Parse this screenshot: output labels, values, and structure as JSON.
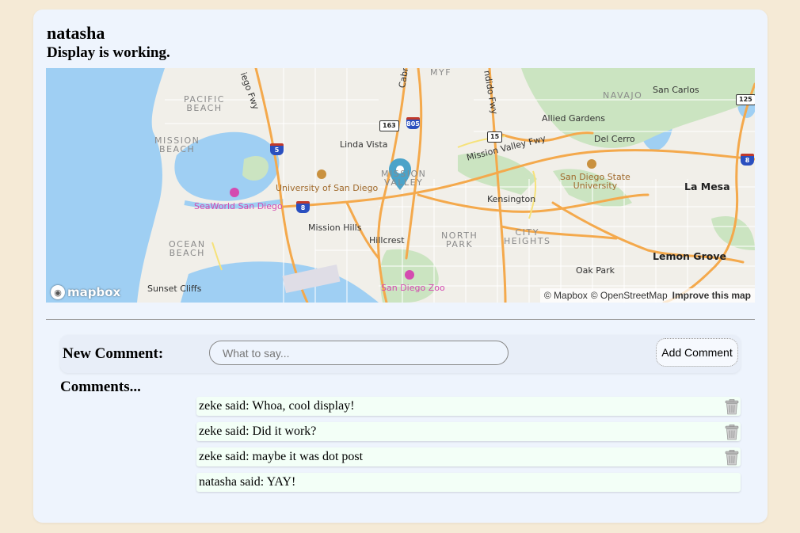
{
  "header": {
    "title": "natasha",
    "subtitle": "Display is working."
  },
  "map": {
    "labels": {
      "pacific_beach": "PACIFIC\nBEACH",
      "mission_beach": "MISSION\nBEACH",
      "ocean_beach": "OCEAN\nBEACH",
      "linda_vista": "Linda Vista",
      "mission_valley": "MISSION\nVALLEY",
      "allied_gardens": "Allied Gardens",
      "san_carlos": "San Carlos",
      "navajo": "NAVAJO",
      "del_cerro": "Del Cerro",
      "mission_valley_fwy": "Mission Valley Fwy",
      "university_san_diego": "University of San Diego",
      "seaworld": "SeaWorld San Diego",
      "kensington": "Kensington",
      "sdsu": "San Diego State\nUniversity",
      "la_mesa": "La Mesa",
      "mission_hills": "Mission Hills",
      "hillcrest": "Hillcrest",
      "north_park": "NORTH\nPARK",
      "city_heights": "CITY\nHEIGHTS",
      "lemon_grove": "Lemon Grove",
      "oak_park": "Oak Park",
      "sunset_cliffs": "Sunset Cliffs",
      "san_diego_zoo": "San Diego Zoo",
      "myf": "MYF",
      "cabrillo": "Cabril",
      "diego_fwy": "iego Fwy",
      "ndido_fwy": "ndido Fwy"
    },
    "shields": {
      "s163": "163",
      "s805": "805",
      "s15": "15",
      "s5": "5",
      "s8a": "8",
      "s8b": "8",
      "s125": "125"
    },
    "logo_text": "mapbox",
    "attribution": {
      "mapbox": "© Mapbox",
      "osm": "© OpenStreetMap",
      "improve": "Improve this map"
    },
    "marker_icon": "map-pin-icon",
    "colors": {
      "water": "#9fcff3",
      "highway": "#f4a94c",
      "park": "#cbe4c1",
      "marker": "#4ba3c9"
    }
  },
  "form": {
    "label": "New Comment:",
    "input_placeholder": "What to say...",
    "input_value": "",
    "button_label": "Add Comment"
  },
  "comments_heading": "Comments...",
  "comments": [
    {
      "text": "zeke said: Whoa, cool display!",
      "deletable": true
    },
    {
      "text": "zeke said: Did it work?",
      "deletable": true
    },
    {
      "text": "zeke said: maybe it was dot post",
      "deletable": true
    },
    {
      "text": "natasha said: YAY!",
      "deletable": false
    }
  ],
  "delete_icon": "trash-icon"
}
